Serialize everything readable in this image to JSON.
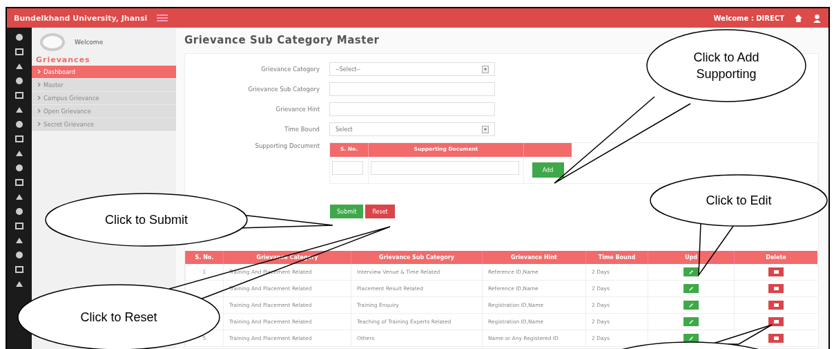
{
  "header": {
    "brand": "Bundelkhand University, Jhansi",
    "welcome": "Welcome : DIRECT"
  },
  "sidebar": {
    "welcome": "Welcome",
    "section": "Grievances",
    "items": [
      {
        "label": "Dashboard",
        "selected": true
      },
      {
        "label": "Master",
        "selected": false
      },
      {
        "label": "Campus Grievance",
        "selected": false
      },
      {
        "label": "Open Grievance",
        "selected": false
      },
      {
        "label": "Secret Grievance",
        "selected": false
      }
    ]
  },
  "page_title": "Grievance Sub Category Master",
  "form": {
    "fields": [
      {
        "label": "Grievance Category",
        "kind": "select",
        "value": "--Select--"
      },
      {
        "label": "Grievance Sub Category",
        "kind": "text"
      },
      {
        "label": "Grievance Hint",
        "kind": "text"
      },
      {
        "label": "Time Bound",
        "kind": "select",
        "value": "Select"
      }
    ],
    "supporting": {
      "label": "Supporting Document",
      "columns": [
        "S. No.",
        "Supporting Document"
      ],
      "add_button": "Add"
    },
    "buttons": [
      {
        "label": "Submit",
        "kind": "primary"
      },
      {
        "label": "Reset",
        "kind": "danger"
      }
    ]
  },
  "table": {
    "columns": [
      "S. No.",
      "Grievance Category",
      "Grievance Sub Category",
      "Grievance Hint",
      "Time Bound",
      "Upd",
      "Delete"
    ],
    "rows": [
      {
        "sno": "1",
        "category": "Training And Placement Related",
        "sub": "Interview Venue & Time Related",
        "hint": "Reference ID,Name",
        "time": "2 Days"
      },
      {
        "category": "Training And Placement Related",
        "sub": "Placement Result Related",
        "hint": "Reference ID,Name",
        "time": "2 Days"
      },
      {
        "category": "Training And Placement Related",
        "sub": "Training Enquiry",
        "hint": "Registration ID,Name",
        "time": "2 Days"
      },
      {
        "category": "Training And Placement Related",
        "sub": "Teaching of Training Experts Related",
        "hint": "Registration ID,Name",
        "time": "2 Days"
      },
      {
        "sno": "5",
        "category": "Training And Placement Related",
        "sub": "Others",
        "hint": "Name or Any Registered ID",
        "time": "2 Days"
      }
    ]
  },
  "callouts": [
    {
      "text": "Click to Add Supporting"
    },
    {
      "text": "Click to Edit"
    },
    {
      "text": "Click to Submit"
    },
    {
      "text": "Click to Reset"
    }
  ]
}
